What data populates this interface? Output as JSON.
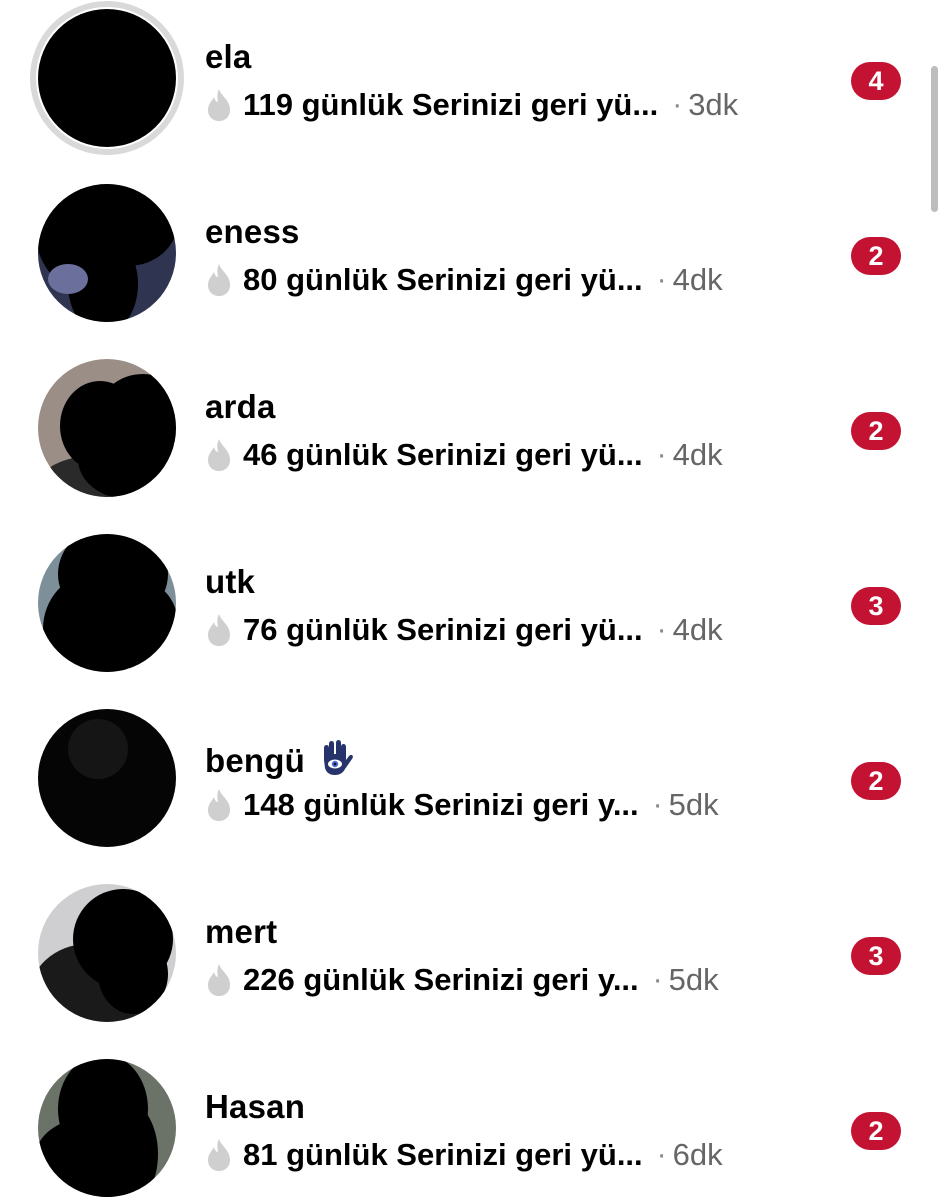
{
  "conversations": [
    {
      "name": "ela",
      "preview": "119 günlük Serinizi geri yü...",
      "dot": "·",
      "time": "3dk",
      "unread": "4",
      "avatar_color": "#000000"
    },
    {
      "name": "eness",
      "preview": "80 günlük Serinizi geri yü...",
      "dot": "·",
      "time": "4dk",
      "unread": "2",
      "avatar_color": "#2f3550"
    },
    {
      "name": "arda",
      "preview": "46 günlük Serinizi geri yü...",
      "dot": "·",
      "time": "4dk",
      "unread": "2",
      "avatar_color": "#9a8e86"
    },
    {
      "name": "utk",
      "preview": "76 günlük Serinizi geri yü...",
      "dot": "·",
      "time": "4dk",
      "unread": "3",
      "avatar_color": "#7d8f99"
    },
    {
      "name": "bengü",
      "preview": "148 günlük Serinizi geri y...",
      "dot": "·",
      "time": "5dk",
      "unread": "2",
      "avatar_color": "#050505",
      "name_emoji": "hamsa-icon"
    },
    {
      "name": "mert",
      "preview": "226 günlük Serinizi geri y...",
      "dot": "·",
      "time": "5dk",
      "unread": "3",
      "avatar_color": "#cfcfd1"
    },
    {
      "name": "Hasan",
      "preview": "81 günlük Serinizi geri yü...",
      "dot": "·",
      "time": "6dk",
      "unread": "2",
      "avatar_color": "#6b7268"
    }
  ],
  "colors": {
    "badge": "#c41233",
    "streak_icon": "#cfcfcf",
    "timestamp": "#666666",
    "story_ring": "#d9d9d9"
  },
  "icons": {
    "streak": "flame-icon",
    "emoji": "hamsa-icon"
  }
}
